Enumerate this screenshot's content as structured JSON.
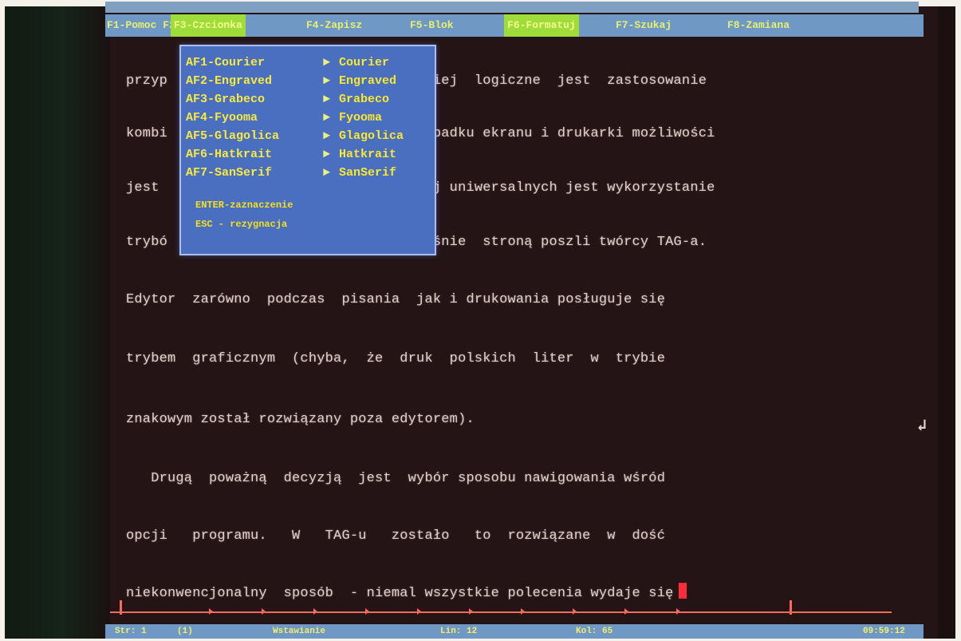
{
  "menu": {
    "item1": "F1-Pomoc F2-Plik",
    "item2": "F3-Czcionka",
    "item3": "F4-Zapisz",
    "item4": "F5-Blok",
    "item5": "F6-Formatuj",
    "item6": "F7-Szukaj",
    "item7": "F8-Zamiana"
  },
  "font_popup": {
    "items": [
      {
        "key": "AF1-Courier",
        "value": "Courier"
      },
      {
        "key": "AF2-Engraved",
        "value": "Engraved"
      },
      {
        "key": "AF3-Grabeco",
        "value": "Grabeco"
      },
      {
        "key": "AF4-Fyooma",
        "value": "Fyooma"
      },
      {
        "key": "AF5-Glagolica",
        "value": "Glagolica"
      },
      {
        "key": "AF6-Hatkrait",
        "value": "Hatkrait"
      },
      {
        "key": "AF7-SanSerif",
        "value": "SanSerif"
      }
    ],
    "footer1": "ENTER-zaznaczenie",
    "footer2": "ESC - rezygnacja"
  },
  "document": {
    "lines": [
      "przyp                              dziej  logiczne  jest  zastosowanie",
      "kombi                               ypadku ekranu i drukarki możliwości",
      "jest                                ej uniwersalnych jest wykorzystanie",
      "trybó                              łaśnie  stroną poszli twórcy TAG-a.",
      "Edytor  zarówno  podczas  pisania  jak i drukowania posługuje się",
      "trybem  graficznym  (chyba,  że  druk  polskich  liter  w  trybie",
      "znakowym został rozwiązany poza edytorem).",
      "   Drugą  poważną  decyzją  jest  wybór sposobu nawigowania wśród",
      "opcji   programu.   W   TAG-u   zostało   to  rozwiązane  w  dość",
      "niekonwencjonalny  sposób  - niemal wszystkie polecenia wydaje się"
    ],
    "return_mark": "↲"
  },
  "status": {
    "page": "Str: 1",
    "col": "(1)",
    "mode": "Wstawianie",
    "line": "Lin: 12",
    "insert": "Kol: 65",
    "time": "09:59:12"
  }
}
